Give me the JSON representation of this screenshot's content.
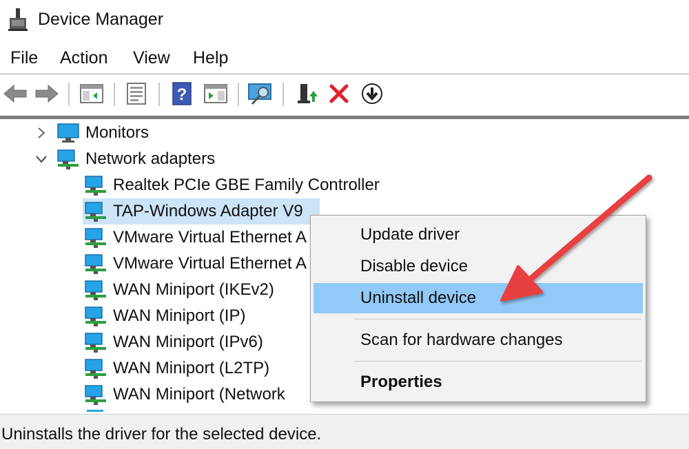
{
  "window": {
    "title": "Device Manager",
    "icon": "device-manager-icon"
  },
  "menu": [
    "File",
    "Action",
    "View",
    "Help"
  ],
  "toolbar": {
    "buttons": [
      "back-arrow-icon",
      "forward-arrow-icon",
      "show-hide-console-tree-icon",
      "properties-icon",
      "help-icon",
      "run-icon",
      "scan-hardware-icon",
      "update-driver-icon",
      "uninstall-x-icon",
      "download-arrow-icon"
    ]
  },
  "tree": {
    "categories": [
      {
        "label": "Monitors",
        "expanded": false
      },
      {
        "label": "Network adapters",
        "expanded": true
      }
    ],
    "devices": [
      "Realtek PCIe GBE Family Controller",
      "TAP-Windows Adapter V9",
      "VMware Virtual Ethernet A",
      "VMware Virtual Ethernet A",
      "WAN Miniport (IKEv2)",
      "WAN Miniport (IP)",
      "WAN Miniport (IPv6)",
      "WAN Miniport (L2TP)",
      "WAN Miniport (Network"
    ],
    "selected_device": "TAP-Windows Adapter V9"
  },
  "context_menu": {
    "items": [
      "Update driver",
      "Disable device",
      "Uninstall device",
      "Scan for hardware changes",
      "Properties"
    ],
    "highlighted": "Uninstall device",
    "bold": "Properties"
  },
  "status": {
    "text": "Uninstalls the driver for the selected device."
  },
  "colors": {
    "selection": "#cce4f7",
    "menu_hover": "#91c9f7",
    "arrow": "#e8403f",
    "icon_blue": "#1c8fd8",
    "icon_green": "#2e9e3f"
  }
}
